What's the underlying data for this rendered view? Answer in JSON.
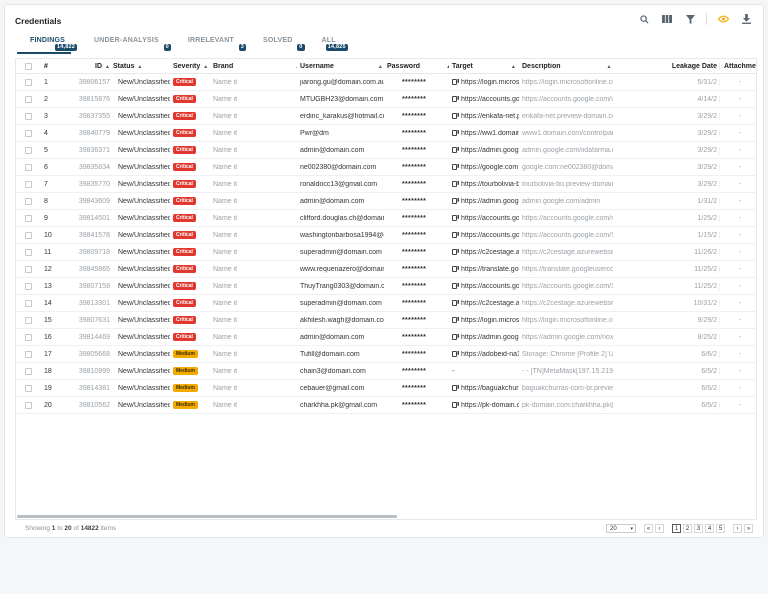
{
  "page": {
    "title": "Credentials"
  },
  "toolbar": {
    "search_icon": "search-icon",
    "columns_icon": "columns-icon",
    "filter_icon": "filter-icon",
    "watch_icon": "eye-icon",
    "download_icon": "download-icon",
    "accent": "#f2a900"
  },
  "tabs": [
    {
      "label": "FINDINGS",
      "count": "14,822"
    },
    {
      "label": "UNDER-ANALYSIS",
      "count": "0"
    },
    {
      "label": "IRRELEVANT",
      "count": "3"
    },
    {
      "label": "SOLVED",
      "count": "0"
    },
    {
      "label": "ALL",
      "count": "14,825"
    }
  ],
  "columns": {
    "index": "#",
    "id": "ID",
    "status": "Status",
    "severity": "Severity",
    "brand": "Brand",
    "username": "Username",
    "password": "Password",
    "target": "Target",
    "description": "Description",
    "leakage_date": "Leakage Date",
    "attachments": "Attachments"
  },
  "rows": [
    {
      "n": "1",
      "id": "39806157",
      "status": "New/Unclassified",
      "severity": "Critical",
      "brand": "Name it",
      "username": "jiarong.gu@domain.com.au",
      "password": "********",
      "target": "https://login.microso",
      "description": "https://login.microsoftonline.com",
      "date": "5/31/2",
      "att": "-"
    },
    {
      "n": "2",
      "id": "39815876",
      "status": "New/Unclassified",
      "severity": "Critical",
      "brand": "Name it",
      "username": "MTUGBH23@domain.com",
      "password": "********",
      "target": "https://accounts.goo",
      "description": "https://accounts.google.com/v3/si",
      "date": "4/14/2",
      "att": "-"
    },
    {
      "n": "3",
      "id": "39837355",
      "status": "New/Unclassified",
      "severity": "Critical",
      "brand": "Name it",
      "username": "erdinc_karakus@hotmail.com",
      "password": "********",
      "target": "https://enkafa-net.p",
      "description": "enkafa-net.preview-domain.com",
      "date": "3/29/2",
      "att": "-"
    },
    {
      "n": "4",
      "id": "39840779",
      "status": "New/Unclassified",
      "severity": "Critical",
      "brand": "Name it",
      "username": "Pwr@dm",
      "password": "********",
      "target": "https://ww1.domain",
      "description": "www1.domain.com/controlpanel/",
      "date": "3/29/2",
      "att": "-"
    },
    {
      "n": "5",
      "id": "39836371",
      "status": "New/Unclassified",
      "severity": "Critical",
      "brand": "Name it",
      "username": "admin@domain.com",
      "password": "********",
      "target": "https://admin.googl",
      "description": "admin.google.com/iidafarma.com",
      "date": "3/29/2",
      "att": "-"
    },
    {
      "n": "6",
      "id": "39835834",
      "status": "New/Unclassified",
      "severity": "Critical",
      "brand": "Name it",
      "username": "ne002380@domain.com",
      "password": "********",
      "target": "https://google.com",
      "description": "google.com:ne002380@domain.co",
      "date": "3/29/2",
      "att": "-"
    },
    {
      "n": "7",
      "id": "39835770",
      "status": "New/Unclassified",
      "severity": "Critical",
      "brand": "Name it",
      "username": "ronaldocc13@gmail.com",
      "password": "********",
      "target": "https://tourbolivia-b",
      "description": "tourbolivia-bo.preview-domain.co",
      "date": "3/29/2",
      "att": "-"
    },
    {
      "n": "8",
      "id": "39843609",
      "status": "New/Unclassified",
      "severity": "Critical",
      "brand": "Name it",
      "username": "admin@domain.com",
      "password": "********",
      "target": "https://admin.goog",
      "description": "admin.google.com/admin",
      "date": "1/31/2",
      "att": "-"
    },
    {
      "n": "9",
      "id": "39814501",
      "status": "New/Unclassified",
      "severity": "Critical",
      "brand": "Name it",
      "username": "clifford.douglas.ch@domain.co",
      "password": "********",
      "target": "https://accounts.goo",
      "description": "https://accounts.google.com/sign",
      "date": "1/25/2",
      "att": "-"
    },
    {
      "n": "10",
      "id": "39841578",
      "status": "New/Unclassified",
      "severity": "Critical",
      "brand": "Name it",
      "username": "washingtonbarbosa1994@don",
      "password": "********",
      "target": "https://accounts.goo",
      "description": "https://accounts.google.com/Sign",
      "date": "1/15/2",
      "att": "-"
    },
    {
      "n": "11",
      "id": "39809718",
      "status": "New/Unclassified",
      "severity": "Critical",
      "brand": "Name it",
      "username": "superadmin@domain.com",
      "password": "********",
      "target": "https://c2cestage.a",
      "description": "https://c2cestage.azurewebsites.",
      "date": "11/26/2",
      "att": "-"
    },
    {
      "n": "12",
      "id": "39845865",
      "status": "New/Unclassified",
      "severity": "Critical",
      "brand": "Name it",
      "username": "www.requenazero@domain.cc",
      "password": "********",
      "target": "https://translate.goo",
      "description": "https://translate.googleusercontent",
      "date": "11/25/2",
      "att": "-"
    },
    {
      "n": "13",
      "id": "39807158",
      "status": "New/Unclassified",
      "severity": "Critical",
      "brand": "Name it",
      "username": "ThuyTrang0303@domain.com",
      "password": "********",
      "target": "https://accounts.goo",
      "description": "https://accounts.google.com/Serv",
      "date": "11/25/2",
      "att": "-"
    },
    {
      "n": "14",
      "id": "39813301",
      "status": "New/Unclassified",
      "severity": "Critical",
      "brand": "Name it",
      "username": "superadmin@domain.com",
      "password": "********",
      "target": "https://c2cestage.a",
      "description": "https://c2cestage.azurewebsites.",
      "date": "10/31/2",
      "att": "-"
    },
    {
      "n": "15",
      "id": "39807631",
      "status": "New/Unclassified",
      "severity": "Critical",
      "brand": "Name it",
      "username": "akhilesh.wagh@domain.com",
      "password": "********",
      "target": "https://login.microso",
      "description": "https://login.microsoftonline.com",
      "date": "9/29/2",
      "att": "-"
    },
    {
      "n": "16",
      "id": "39814469",
      "status": "New/Unclassified",
      "severity": "Critical",
      "brand": "Name it",
      "username": "admin@domain.com",
      "password": "********",
      "target": "https://admin.googl",
      "description": "https://admin.google.com/noxaini",
      "date": "8/25/2",
      "att": "-"
    },
    {
      "n": "17",
      "id": "39805668",
      "status": "New/Unclassified",
      "severity": "Medium",
      "brand": "Name it",
      "username": "Tufill@domain.com",
      "password": "********",
      "target": "https://adobeid-na1",
      "description": "Storage: Chrome [Profile 2] URL: h",
      "date": "6/6/2",
      "att": "-"
    },
    {
      "n": "18",
      "id": "39810999",
      "status": "New/Unclassified",
      "severity": "Medium",
      "brand": "Name it",
      "username": "chain3@domain.com",
      "password": "********",
      "target": "-",
      "description": "- - [TN]MetaMask[197.15.219.45 r",
      "date": "6/5/2",
      "att": "-"
    },
    {
      "n": "19",
      "id": "39814381",
      "status": "New/Unclassified",
      "severity": "Medium",
      "brand": "Name it",
      "username": "cebauer@gmail.com",
      "password": "********",
      "target": "https://baguakchurra",
      "description": "baguakchurras-com-br.preview-do",
      "date": "6/5/2",
      "att": "-"
    },
    {
      "n": "20",
      "id": "39810562",
      "status": "New/Unclassified",
      "severity": "Medium",
      "brand": "Name it",
      "username": "charkhha.pk@gmail.com",
      "password": "********",
      "target": "https://pk-domain.co",
      "description": "pk-domain.com:charkhha.pk@gm",
      "date": "6/5/2",
      "att": "-"
    }
  ],
  "footer": {
    "showing": "Showing",
    "from": "1",
    "to_word": "to",
    "to": "20",
    "of_word": "of",
    "total": "14822",
    "items_word": "items",
    "page_size": "20",
    "pages": [
      "1",
      "2",
      "3",
      "4",
      "5"
    ],
    "first": "«",
    "prev": "‹",
    "next": "›",
    "last": "»"
  },
  "colors": {
    "critical": "#e0382f",
    "medium": "#f2a900",
    "primary": "#1b4b6b"
  }
}
